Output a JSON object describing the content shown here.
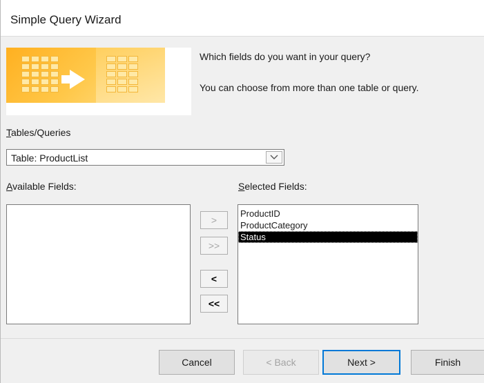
{
  "window": {
    "title": "Simple Query Wizard"
  },
  "intro": {
    "line1": "Which fields do you want in your query?",
    "line2": "You can choose from more than one table or query."
  },
  "tables_label": {
    "accel": "T",
    "rest": "ables/Queries"
  },
  "tables_combo": {
    "value": "Table: ProductList",
    "icon": "chevron-down-icon"
  },
  "available_label": {
    "accel": "A",
    "rest": "vailable Fields:"
  },
  "selected_label": {
    "accel": "S",
    "rest": "elected Fields:"
  },
  "available_fields": [],
  "selected_fields": [
    {
      "name": "ProductID",
      "selected": false
    },
    {
      "name": "ProductCategory",
      "selected": false
    },
    {
      "name": "Status",
      "selected": true
    }
  ],
  "move_buttons": {
    "add_one": ">",
    "add_all": ">>",
    "remove_one": "<",
    "remove_all": "<<"
  },
  "footer": {
    "cancel": "Cancel",
    "back": "< Back",
    "next": "Next >",
    "finish": "Finish"
  },
  "colors": {
    "accent": "#0078d7",
    "selection": "#000000",
    "wizard_art": "#ffb020"
  }
}
